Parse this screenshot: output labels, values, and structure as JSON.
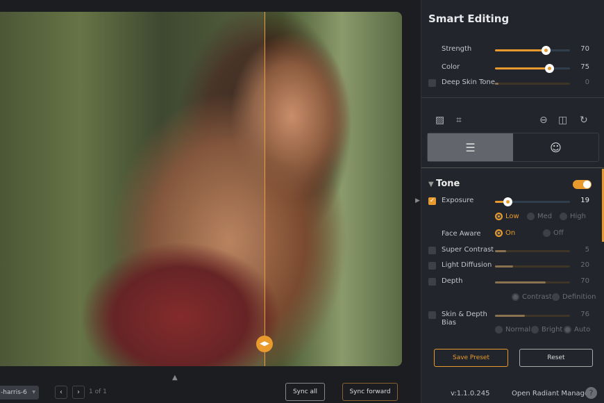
{
  "viewer": {
    "compare_handle_icon": "split-arrows-icon",
    "collapse_icon": "triangle-up-icon"
  },
  "bottom": {
    "filename": "-harris-6",
    "prev": "‹",
    "next": "›",
    "page": "1 of 1",
    "sync_all": "Sync all",
    "sync_forward": "Sync forward"
  },
  "panel": {
    "title": "Smart Editing",
    "strength": {
      "label": "Strength",
      "value": "70"
    },
    "color": {
      "label": "Color",
      "value": "75"
    },
    "deep_skin": {
      "label": "Deep Skin Tone",
      "value": "0",
      "checked": false
    },
    "tools": [
      "histogram-icon",
      "crop-icon",
      "flip-vertical-icon",
      "flip-horizontal-icon",
      "rotate-icon"
    ],
    "tabs": [
      {
        "icon": "sliders-icon",
        "active": true
      },
      {
        "icon": "face-icon",
        "active": false
      }
    ],
    "tone": {
      "title": "Tone",
      "enabled": true,
      "exposure": {
        "label": "Exposure",
        "value": "19",
        "checked": true,
        "options": [
          "Low",
          "Med",
          "High"
        ],
        "selected": "Low"
      },
      "face_aware": {
        "label": "Face Aware",
        "options": [
          "On",
          "Off"
        ],
        "selected": "On"
      },
      "super_contrast": {
        "label": "Super Contrast",
        "value": "5"
      },
      "light_diffusion": {
        "label": "Light Diffusion",
        "value": "20"
      },
      "depth": {
        "label": "Depth",
        "value": "70",
        "options": [
          "Contrast",
          "Definition"
        ],
        "selected": "Contrast"
      },
      "skin_depth": {
        "label": "Skin & Depth",
        "label2": "Bias",
        "value": "76",
        "options": [
          "Normal",
          "Bright",
          "Auto"
        ],
        "selected": "Auto"
      }
    },
    "save_preset": "Save Preset",
    "reset": "Reset",
    "version": "v:1.1.0.245",
    "open_manager": "Open Radiant Manager",
    "help": "?"
  },
  "colors": {
    "accent": "#e89a2c",
    "panel": "#22252b",
    "background": "#1c1d21"
  }
}
